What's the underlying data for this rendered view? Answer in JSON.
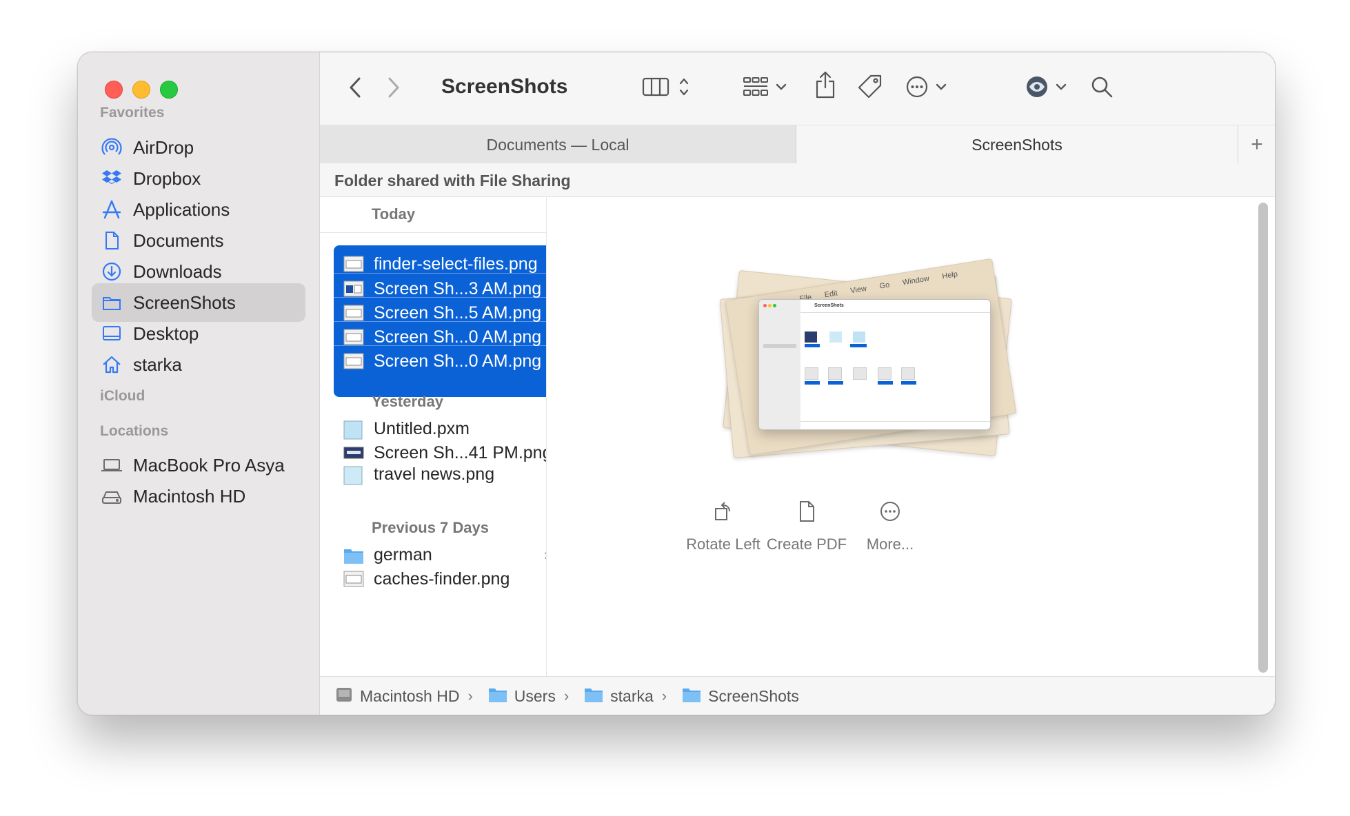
{
  "window": {
    "title": "ScreenShots",
    "controls": [
      "close",
      "minimize",
      "zoom"
    ]
  },
  "sidebar": {
    "sections": {
      "favorites": "Favorites",
      "icloud": "iCloud",
      "locations": "Locations"
    },
    "favorites": [
      {
        "label": "AirDrop",
        "icon": "airdrop-icon"
      },
      {
        "label": "Dropbox",
        "icon": "dropbox-icon"
      },
      {
        "label": "Applications",
        "icon": "applications-icon"
      },
      {
        "label": "Documents",
        "icon": "document-icon"
      },
      {
        "label": "Downloads",
        "icon": "downloads-icon"
      },
      {
        "label": "ScreenShots",
        "icon": "folder-icon",
        "selected": true
      },
      {
        "label": "Desktop",
        "icon": "desktop-icon"
      },
      {
        "label": "starka",
        "icon": "home-icon"
      }
    ],
    "locations": [
      {
        "label": "MacBook Pro Asya",
        "icon": "laptop-icon"
      },
      {
        "label": "Macintosh HD",
        "icon": "drive-icon"
      }
    ]
  },
  "toolbar": {
    "back_icon": "chevron-left-icon",
    "forward_icon": "chevron-right-icon",
    "view_icon": "columns-view-icon",
    "group_icon": "grid-group-icon",
    "share_icon": "share-icon",
    "tag_icon": "tag-icon",
    "more_icon": "ellipsis-circle-icon",
    "preview_icon": "eye-icon",
    "search_icon": "search-icon"
  },
  "tabs": [
    {
      "label": "Documents — Local",
      "active": false
    },
    {
      "label": "ScreenShots",
      "active": true
    }
  ],
  "tab_add_label": "+",
  "shared_banner": "Folder shared with File Sharing",
  "file_list": {
    "groups": {
      "today": "Today",
      "yesterday": "Yesterday",
      "previous": "Previous 7 Days"
    },
    "today": [
      {
        "name": "finder-select-files.png",
        "selected": true
      },
      {
        "name": "Screen Sh...3 AM.png",
        "selected": true
      },
      {
        "name": "Screen Sh...5 AM.png",
        "selected": true
      },
      {
        "name": "Screen Sh...0 AM.png",
        "selected": true
      },
      {
        "name": "Screen Sh...0 AM.png",
        "selected": true
      }
    ],
    "yesterday": [
      {
        "name": "Untitled.pxm"
      },
      {
        "name": "Screen Sh...41 PM.png"
      },
      {
        "name": "travel news.png"
      }
    ],
    "previous": [
      {
        "name": "german",
        "type": "folder"
      },
      {
        "name": "caches-finder.png"
      }
    ],
    "column_resize_glyph": "||"
  },
  "preview": {
    "actions": [
      {
        "label": "Rotate Left",
        "icon": "rotate-left-icon"
      },
      {
        "label": "Create PDF",
        "icon": "create-pdf-icon"
      },
      {
        "label": "More...",
        "icon": "ellipsis-circle-icon"
      }
    ],
    "mini_menu": [
      "File",
      "Edit",
      "View",
      "Go",
      "Window",
      "Help"
    ],
    "mini_title": "ScreenShots"
  },
  "path_bar": [
    {
      "label": "Macintosh HD",
      "icon": "drive-icon"
    },
    {
      "label": "Users",
      "icon": "folder-icon"
    },
    {
      "label": "starka",
      "icon": "folder-icon"
    },
    {
      "label": "ScreenShots",
      "icon": "folder-icon"
    }
  ],
  "colors": {
    "selection": "#0b62d6",
    "sidebar_bg": "#e9e7e8",
    "accent_icon": "#3478f6"
  }
}
